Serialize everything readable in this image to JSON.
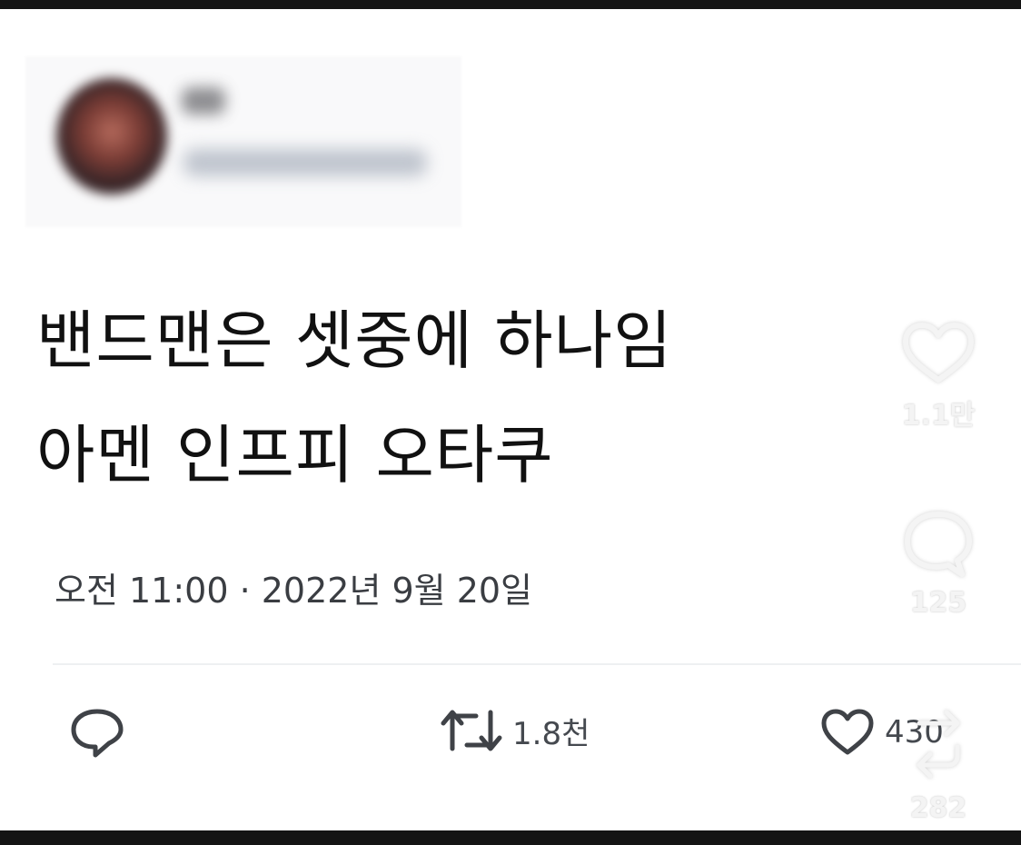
{
  "tweet": {
    "lines": [
      "밴드맨은 셋중에 하나임",
      "아멘 인프피 오타쿠"
    ],
    "timestamp": "오전 11:00 · 2022년 9월 20일"
  },
  "actions": {
    "reply_icon": "comment-bubble-icon",
    "retweet_icon": "retweet-icon",
    "retweet_count": "1.8천",
    "like_icon": "heart-outline-icon",
    "like_count": "430"
  },
  "overlay": {
    "like_icon": "heart-outline-icon",
    "like_count": "1.1만",
    "comment_icon": "comment-bubble-icon",
    "comment_count": "125",
    "repost_icon": "repost-icon",
    "repost_count": "282"
  },
  "colors": {
    "text": "#111111",
    "meta_text": "#3a3d42",
    "frame": "#141414",
    "overlay_icons": "#f4f4f4"
  }
}
